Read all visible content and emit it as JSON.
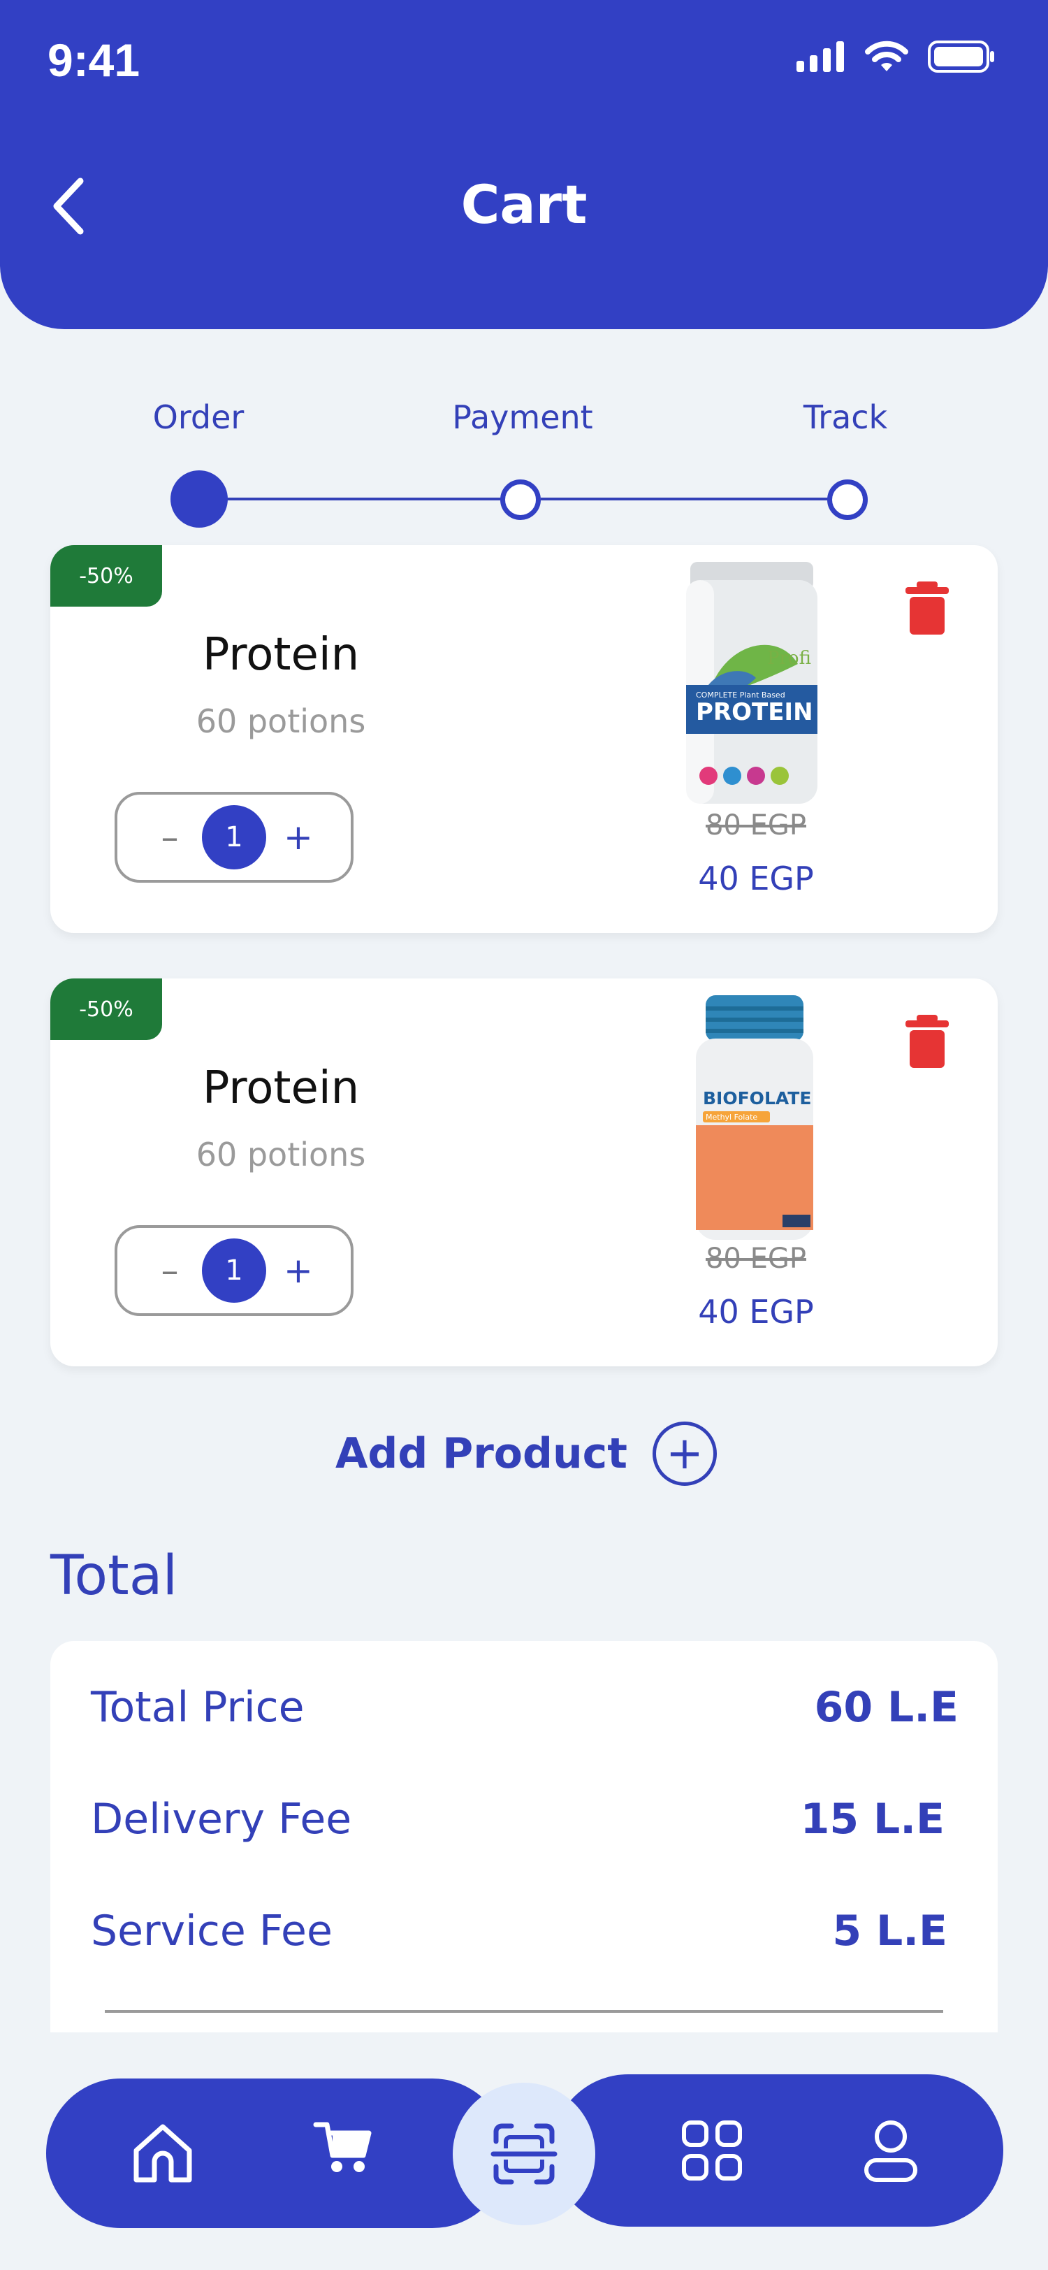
{
  "status_bar": {
    "time": "9:41"
  },
  "header": {
    "title": "Cart"
  },
  "stepper": {
    "steps": [
      {
        "label": "Order",
        "state": "current"
      },
      {
        "label": "Payment",
        "state": "pending"
      },
      {
        "label": "Track",
        "state": "pending"
      }
    ]
  },
  "cart": {
    "items": [
      {
        "discount": "-50%",
        "name": "Protein",
        "description": "60 potions",
        "quantity": "1",
        "old_price": "80 EGP",
        "new_price": "40 EGP",
        "image": {
          "icon": "protein-jar",
          "brand": "Profi",
          "label_lines": [
            "COMPLETE Plant Based",
            "PROTEIN"
          ]
        }
      },
      {
        "discount": "-50%",
        "name": "Protein",
        "description": "60 potions",
        "quantity": "1",
        "old_price": "80 EGP",
        "new_price": "40 EGP",
        "image": {
          "icon": "biofolate-bottle",
          "label_lines": [
            "BIOFOLATE",
            "Methyl Folate"
          ]
        }
      }
    ],
    "add_product_label": "Add Product"
  },
  "total": {
    "heading": "Total",
    "rows": [
      {
        "label": "Total Price",
        "value": "60 L.E"
      },
      {
        "label": "Delivery Fee",
        "value": "15 L.E"
      },
      {
        "label": "Service Fee",
        "value": "5 L.E"
      }
    ]
  },
  "bottom_nav": {
    "items": [
      "home-icon",
      "cart-icon",
      "scan-icon",
      "grid-icon",
      "profile-icon"
    ]
  },
  "colors": {
    "primary": "#3240c4",
    "discount": "#1f7a39",
    "trash": "#e63434",
    "background": "#eff3f7",
    "scan_bg": "#dde8fb"
  }
}
